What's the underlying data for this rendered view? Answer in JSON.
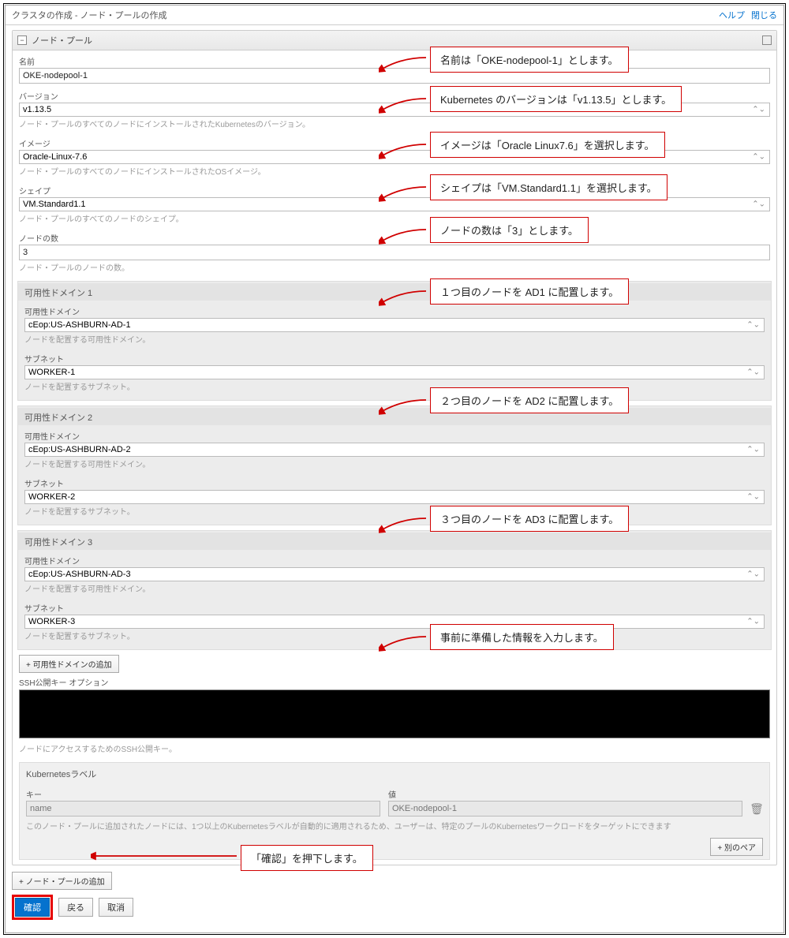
{
  "header": {
    "title": "クラスタの作成 - ノード・プールの作成",
    "help": "ヘルプ",
    "close": "閉じる"
  },
  "section": {
    "title": "ノード・プール"
  },
  "fields": {
    "name": {
      "label": "名前",
      "value": "OKE-nodepool-1"
    },
    "version": {
      "label": "バージョン",
      "value": "v1.13.5",
      "help": "ノード・プールのすべてのノードにインストールされたKubernetesのバージョン。"
    },
    "image": {
      "label": "イメージ",
      "value": "Oracle-Linux-7.6",
      "help": "ノード・プールのすべてのノードにインストールされたOSイメージ。"
    },
    "shape": {
      "label": "シェイプ",
      "value": "VM.Standard1.1",
      "help": "ノード・プールのすべてのノードのシェイプ。"
    },
    "count": {
      "label": "ノードの数",
      "value": "3",
      "help": "ノード・プールのノードの数。"
    }
  },
  "ad_groups": [
    {
      "title": "可用性ドメイン 1",
      "ad_label": "可用性ドメイン",
      "ad_value": "cEop:US-ASHBURN-AD-1",
      "ad_help": "ノードを配置する可用性ドメイン。",
      "subnet_label": "サブネット",
      "subnet_value": "WORKER-1",
      "subnet_help": "ノードを配置するサブネット。"
    },
    {
      "title": "可用性ドメイン 2",
      "ad_label": "可用性ドメイン",
      "ad_value": "cEop:US-ASHBURN-AD-2",
      "ad_help": "ノードを配置する可用性ドメイン。",
      "subnet_label": "サブネット",
      "subnet_value": "WORKER-2",
      "subnet_help": "ノードを配置するサブネット。"
    },
    {
      "title": "可用性ドメイン 3",
      "ad_label": "可用性ドメイン",
      "ad_value": "cEop:US-ASHBURN-AD-3",
      "ad_help": "ノードを配置する可用性ドメイン。",
      "subnet_label": "サブネット",
      "subnet_value": "WORKER-3",
      "subnet_help": "ノードを配置するサブネット。"
    }
  ],
  "add_ad": "+ 可用性ドメインの追加",
  "ssh": {
    "label": "SSH公開キー  オプション",
    "help": "ノードにアクセスするためのSSH公開キー。"
  },
  "kube": {
    "title": "Kubernetesラベル",
    "key_label": "キー",
    "val_label": "値",
    "key_placeholder": "name",
    "val_placeholder": "OKE-nodepool-1",
    "help": "このノード・プールに追加されたノードには、1つ以上のKubernetesラベルが自動的に適用されるため、ユーザーは、特定のプールのKubernetesワークロードをターゲットにできます",
    "add_pair": "+ 別のペア"
  },
  "add_pool": "+ ノード・プールの追加",
  "buttons": {
    "confirm": "確認",
    "back": "戻る",
    "cancel": "取消"
  },
  "callouts": {
    "c1": "名前は「OKE-nodepool-1」とします。",
    "c2": "Kubernetes のバージョンは「v1.13.5」とします。",
    "c3": "イメージは「Oracle Linux7.6」を選択します。",
    "c4": "シェイプは「VM.Standard1.1」を選択します。",
    "c5": "ノードの数は「3」とします。",
    "c6": "１つ目のノードを AD1 に配置します。",
    "c7": "２つ目のノードを AD2 に配置します。",
    "c8": "３つ目のノードを AD3 に配置します。",
    "c9": "事前に準備した情報を入力します。",
    "c10": "「確認」を押下します。"
  }
}
